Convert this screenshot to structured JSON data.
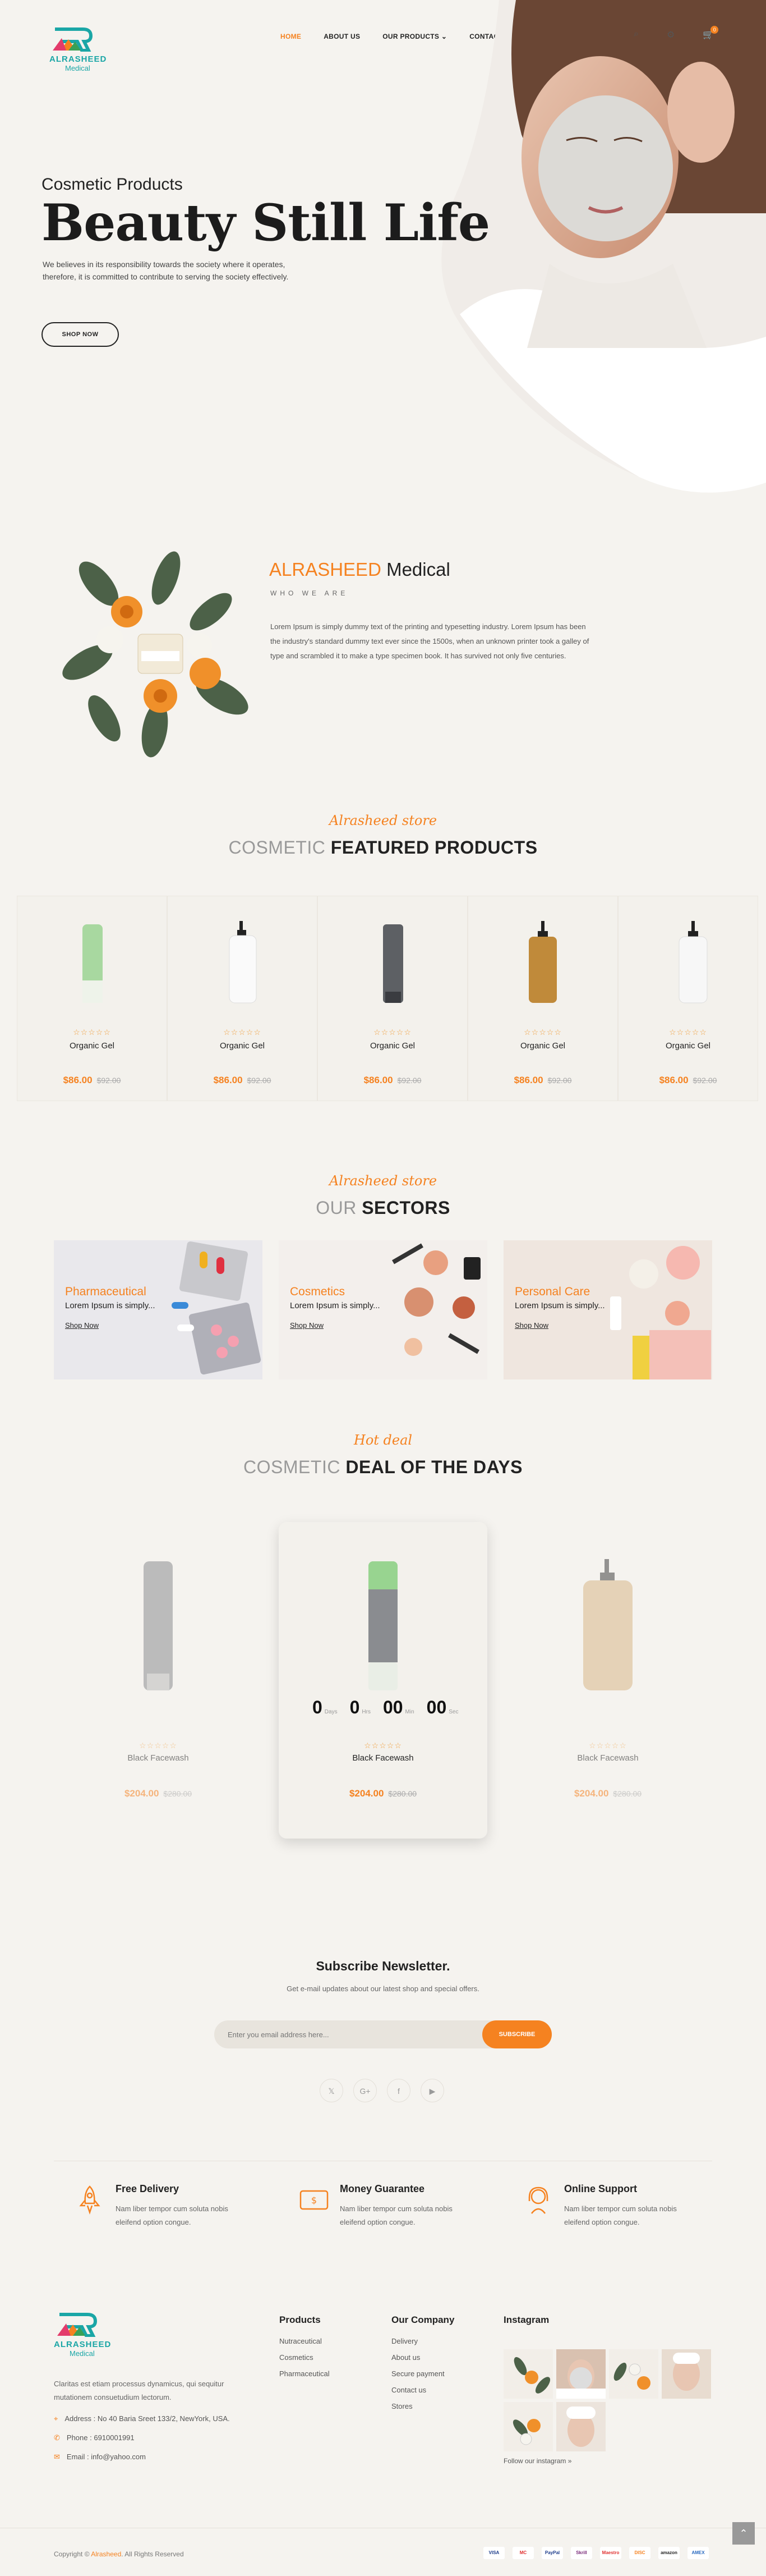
{
  "brand": {
    "name": "ALRASHEED",
    "sub": "Medical",
    "colors": {
      "accent": "#f58220",
      "teal": "#1aa6a6"
    }
  },
  "nav": {
    "items": [
      "HOME",
      "ABOUT US",
      "OUR PRODUCTS",
      "CONTACT"
    ]
  },
  "header": {
    "cart_count": "0",
    "icons": [
      "search-icon",
      "gear-icon",
      "cart-icon"
    ]
  },
  "hero": {
    "subtitle": "Cosmetic Products",
    "title": "Beauty Still Life",
    "text": "We believes in its responsibility towards the society where it operates, therefore, it is committed to contribute to serving the society effectively.",
    "button": "SHOP NOW"
  },
  "about": {
    "brand_a": "ALRASHEED",
    "brand_b": " Medical",
    "who": "WHO WE ARE",
    "text": "Lorem Ipsum is simply dummy text of the printing and typesetting industry. Lorem Ipsum has been the industry's standard dummy text ever since the 1500s, when an unknown printer took a galley of type and scrambled it to make a type specimen book. It has survived not only five centuries."
  },
  "featured": {
    "script": "Alrasheed store",
    "title_light": "COSMETIC",
    "title_bold": "FEATURED PRODUCTS",
    "products": [
      {
        "name": "Organic Gel",
        "stars": "☆☆☆☆☆",
        "price": "$86.00",
        "old": "$92.00"
      },
      {
        "name": "Organic Gel",
        "stars": "☆☆☆☆☆",
        "price": "$86.00",
        "old": "$92.00"
      },
      {
        "name": "Organic Gel",
        "stars": "☆☆☆☆☆",
        "price": "$86.00",
        "old": "$92.00"
      },
      {
        "name": "Organic Gel",
        "stars": "☆☆☆☆☆",
        "price": "$86.00",
        "old": "$92.00"
      },
      {
        "name": "Organic Gel",
        "stars": "☆☆☆☆☆",
        "price": "$86.00",
        "old": "$92.00"
      }
    ]
  },
  "sectors": {
    "script": "Alrasheed store",
    "title_light": "OUR",
    "title_bold": "SECTORS",
    "items": [
      {
        "title": "Pharmaceutical",
        "desc": "Lorem Ipsum is simply...",
        "link": "Shop Now"
      },
      {
        "title": "Cosmetics",
        "desc": "Lorem Ipsum is simply...",
        "link": "Shop Now"
      },
      {
        "title": "Personal Care",
        "desc": "Lorem Ipsum is simply...",
        "link": "Shop Now"
      }
    ]
  },
  "deals": {
    "script": "Hot deal",
    "title_light": "COSMETIC",
    "title_bold": "DEAL OF THE DAYS",
    "items": [
      {
        "name": "Black Facewash",
        "stars": "☆☆☆☆☆",
        "price": "$204.00",
        "old": "$280.00"
      },
      {
        "name": "Black Facewash",
        "stars": "☆☆☆☆☆",
        "price": "$204.00",
        "old": "$280.00"
      },
      {
        "name": "Black Facewash",
        "stars": "☆☆☆☆☆",
        "price": "$204.00",
        "old": "$280.00"
      }
    ],
    "countdown": [
      {
        "v": "0",
        "u": "Days"
      },
      {
        "v": "0",
        "u": "Hrs"
      },
      {
        "v": "00",
        "u": "Min"
      },
      {
        "v": "00",
        "u": "Sec"
      }
    ]
  },
  "newsletter": {
    "title": "Subscribe Newsletter.",
    "sub": "Get e-mail updates about our latest shop and special offers.",
    "placeholder": "Enter you email address here...",
    "button": "SUBSCRIBE"
  },
  "social": [
    "𝕏",
    "G+",
    "f",
    "▶"
  ],
  "features": [
    {
      "title": "Free Delivery",
      "text": "Nam liber tempor cum soluta nobis eleifend option congue."
    },
    {
      "title": "Money Guarantee",
      "text": "Nam liber tempor cum soluta nobis eleifend option congue."
    },
    {
      "title": "Online Support",
      "text": "Nam liber tempor cum soluta nobis eleifend option congue."
    }
  ],
  "footer": {
    "about": "Claritas est etiam processus dynamicus, qui sequitur mutationem consuetudium lectorum.",
    "address": "Address : No 40 Baria Sreet 133/2, NewYork, USA.",
    "phone": "Phone : 6910001991",
    "email": "Email : info@yahoo.com",
    "products_title": "Products",
    "products": [
      "Nutraceutical",
      "Cosmetics",
      "Pharmaceutical"
    ],
    "company_title": "Our Company",
    "company": [
      "Delivery",
      "About us",
      "Secure payment",
      "Contact us",
      "Stores"
    ],
    "instagram_title": "Instagram",
    "instagram_link": "Follow our instagram »",
    "copy_a": "Copyright © ",
    "copy_b": "Alrasheed",
    "copy_c": ". All Rights Reserved",
    "payments": [
      "VISA",
      "MC",
      "PayPal",
      "Skrill",
      "Maestro",
      "DISC",
      "amazon",
      "AMEX"
    ]
  }
}
